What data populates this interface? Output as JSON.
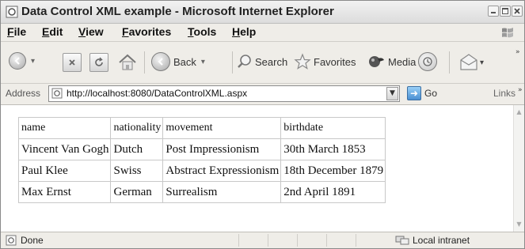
{
  "window": {
    "title": "Data Control XML example - Microsoft Internet Explorer"
  },
  "menu": {
    "items": [
      {
        "key": "F",
        "rest": "ile"
      },
      {
        "key": "E",
        "rest": "dit"
      },
      {
        "key": "V",
        "rest": "iew"
      },
      {
        "key": "F",
        "rest": "avorites",
        "prefix": ""
      },
      {
        "key": "T",
        "rest": "ools"
      },
      {
        "key": "H",
        "rest": "elp"
      }
    ]
  },
  "toolbar": {
    "back_label": "Back",
    "search_label": "Search",
    "favorites_label": "Favorites",
    "media_label": "Media"
  },
  "address": {
    "label": "Address",
    "url": "http://localhost:8080/DataControlXML.aspx",
    "go_label": "Go",
    "links_label": "Links"
  },
  "table": {
    "headers": [
      "name",
      "nationality",
      "movement",
      "birthdate"
    ],
    "rows": [
      [
        "Vincent Van Gogh",
        "Dutch",
        "Post Impressionism",
        "30th March 1853"
      ],
      [
        "Paul Klee",
        "Swiss",
        "Abstract Expressionism",
        "18th December 1879"
      ],
      [
        "Max Ernst",
        "German",
        "Surrealism",
        "2nd April 1891"
      ]
    ]
  },
  "status": {
    "text": "Done",
    "zone": "Local intranet"
  }
}
